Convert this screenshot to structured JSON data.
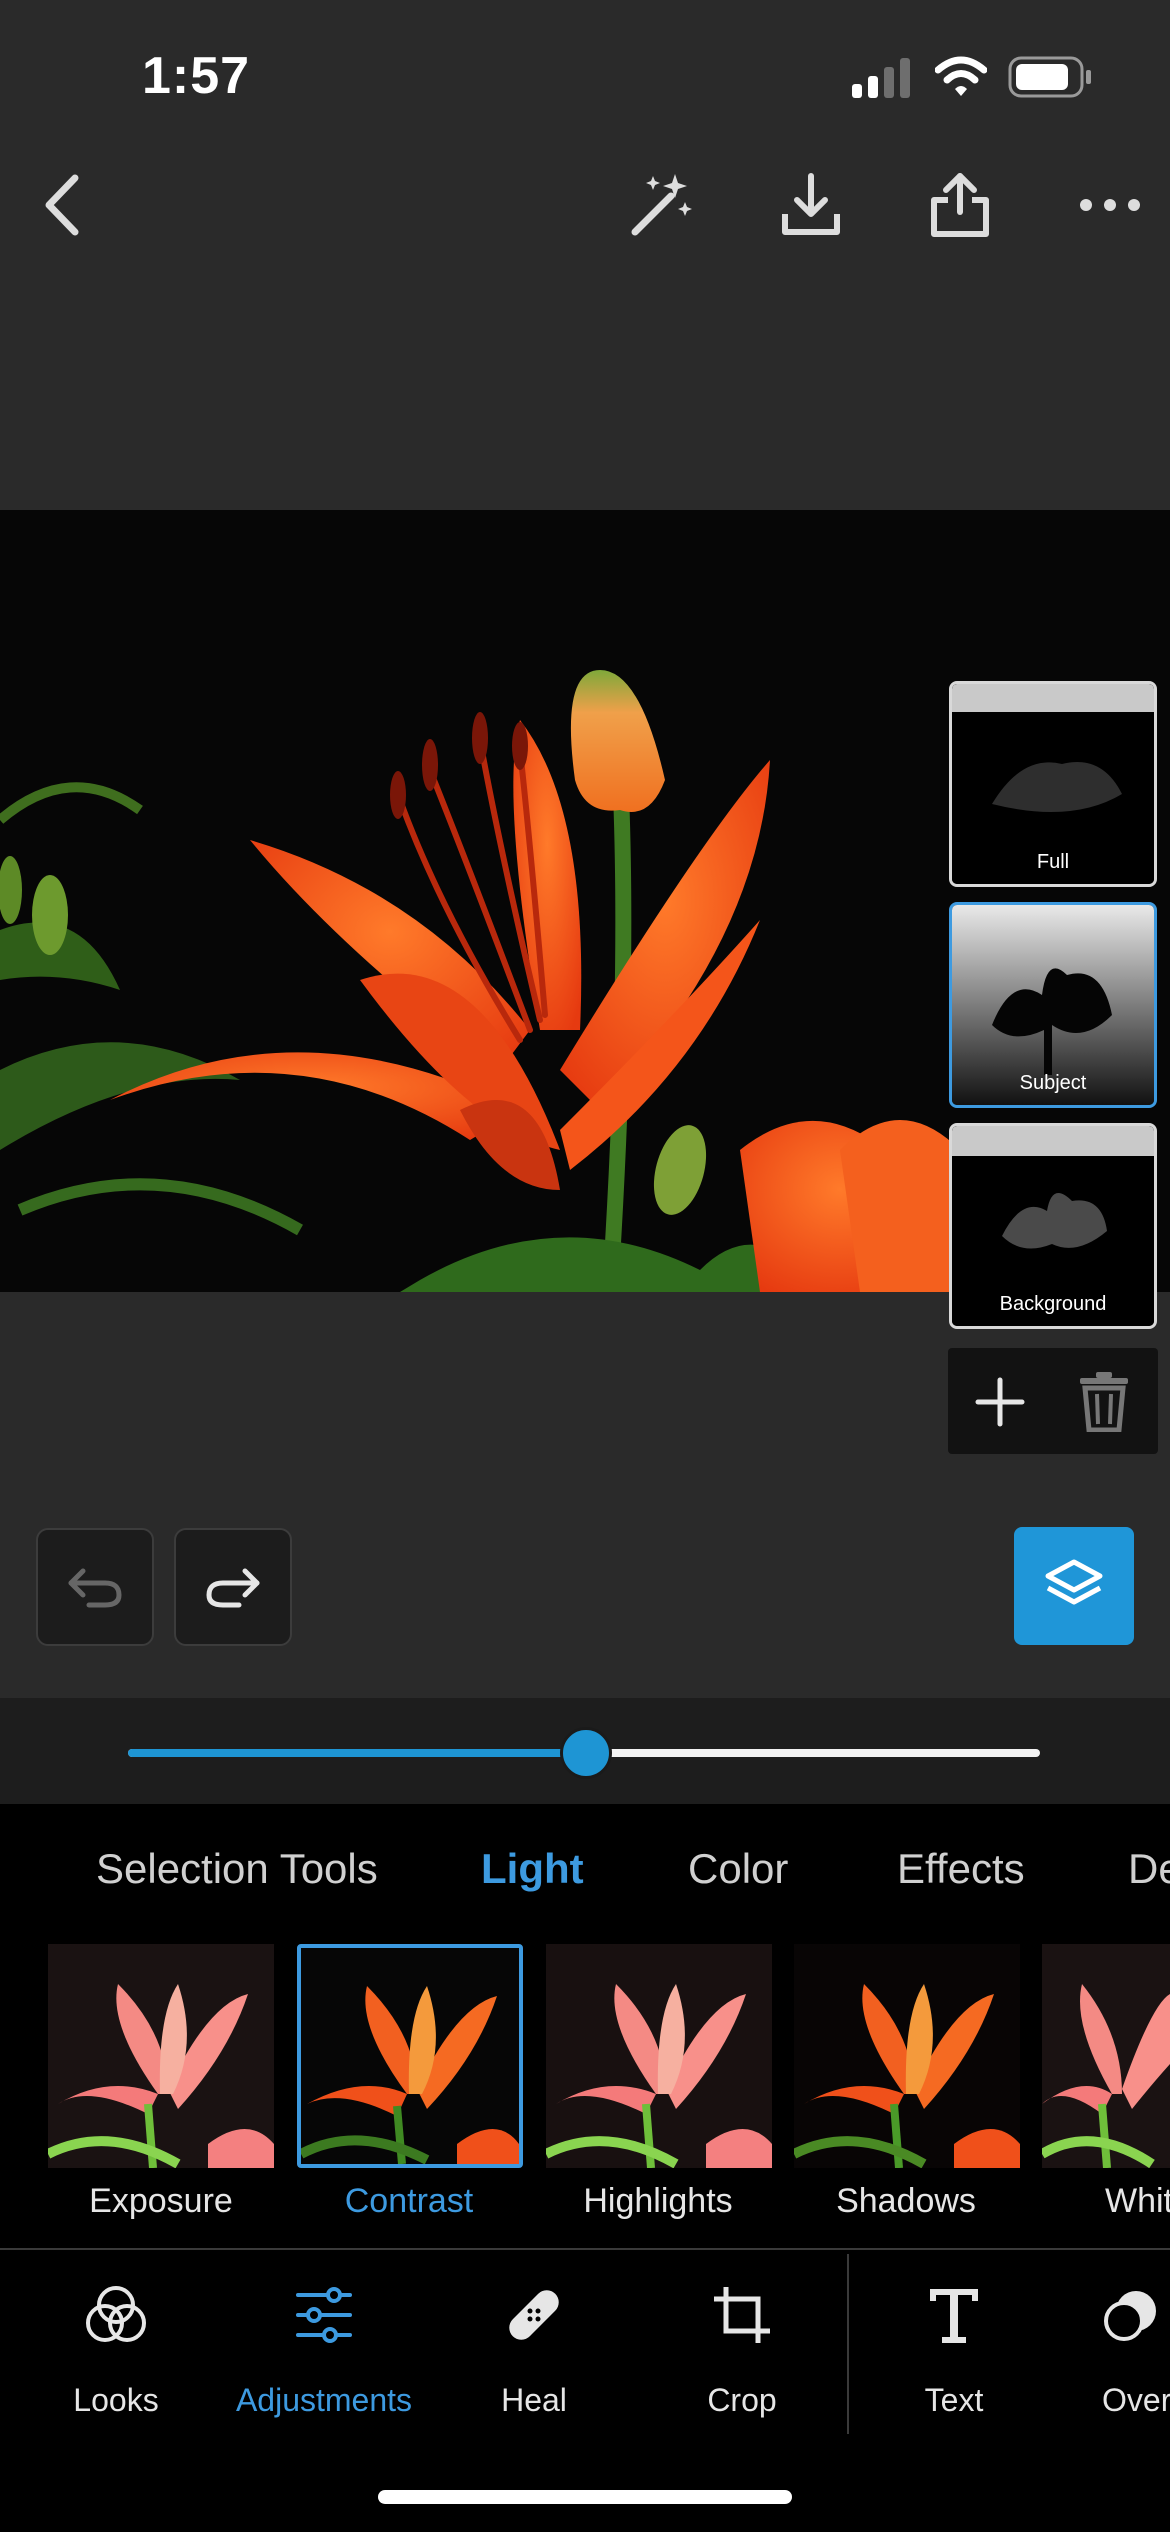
{
  "status_bar": {
    "time": "1:57",
    "signal_icon": "signal-icon",
    "wifi_icon": "wifi-icon",
    "battery_icon": "battery-icon"
  },
  "toolbar": {
    "back_icon": "chevron-left-icon",
    "auto_icon": "magic-wand-icon",
    "download_icon": "download-icon",
    "share_icon": "share-icon",
    "more_icon": "more-horizontal-icon"
  },
  "masks": {
    "items": [
      {
        "label": "Full"
      },
      {
        "label": "Subject"
      },
      {
        "label": "Background"
      }
    ],
    "selected": "Subject",
    "add_icon": "plus-icon",
    "delete_icon": "trash-icon"
  },
  "history": {
    "undo_icon": "undo-icon",
    "redo_icon": "redo-icon"
  },
  "layers_icon": "layers-icon",
  "slider": {
    "value_fraction": 0.502
  },
  "categories": {
    "tabs": [
      "Selection Tools",
      "Light",
      "Color",
      "Effects",
      "De"
    ],
    "active": "Light"
  },
  "presets": {
    "items": [
      "Exposure",
      "Contrast",
      "Highlights",
      "Shadows",
      "Whit"
    ],
    "selected": "Contrast"
  },
  "bottom_nav": {
    "items": [
      "Looks",
      "Adjustments",
      "Heal",
      "Crop",
      "Text",
      "Over"
    ],
    "active": "Adjustments"
  },
  "colors": {
    "accent": "#3d9ae0",
    "background": "#2a2a2a",
    "panel": "#000000"
  }
}
